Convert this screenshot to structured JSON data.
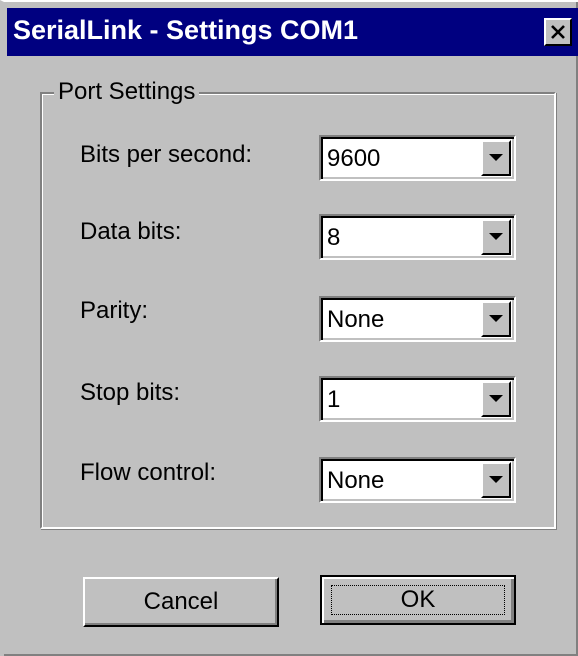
{
  "window": {
    "title": "SerialLink - Settings COM1",
    "close_symbol": "close-icon"
  },
  "group": {
    "label": "Port Settings"
  },
  "fields": [
    {
      "label": "Bits per second:",
      "value": "9600"
    },
    {
      "label": "Data bits:",
      "value": "8"
    },
    {
      "label": "Parity:",
      "value": "None"
    },
    {
      "label": "Stop bits:",
      "value": "1"
    },
    {
      "label": "Flow control:",
      "value": "None"
    }
  ],
  "buttons": {
    "cancel": "Cancel",
    "ok": "OK"
  },
  "colors": {
    "titlebar": "#000080",
    "face": "#c0c0c0"
  }
}
